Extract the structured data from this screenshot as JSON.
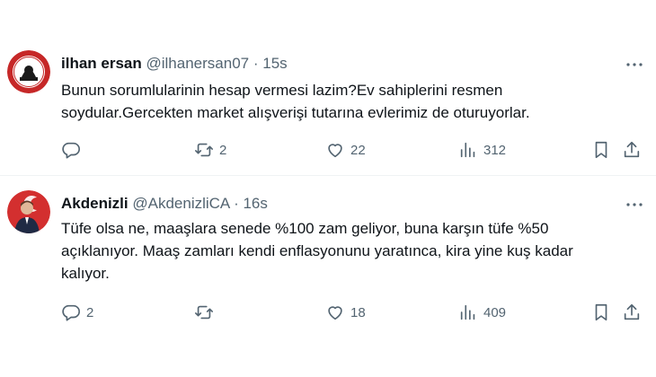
{
  "tweets": [
    {
      "name": "ilhan ersan",
      "handle": "@ilhanersan07",
      "sep": "·",
      "time": "15s",
      "text_line1": "Bunun sorumlularinin hesap vermesi lazim?Ev sahiplerini resmen",
      "text_line2": "soydular.Gercekten market alışverişi tutarına evlerimiz de oturuyorlar.",
      "text_line3": "",
      "replies": "",
      "retweets": "2",
      "likes": "22",
      "views": "312"
    },
    {
      "name": "Akdenizli",
      "handle": "@AkdenizliCA",
      "sep": "·",
      "time": "16s",
      "text_line1": "Tüfe olsa ne, maaşlara senede %100 zam geliyor, buna karşın tüfe %50",
      "text_line2": "açıklanıyor. Maaş zamları kendi enflasyonunu yaratınca, kira yine kuş kadar",
      "text_line3": "kalıyor.",
      "replies": "2",
      "retweets": "",
      "likes": "18",
      "views": "409"
    }
  ],
  "icons": {
    "reply": "reply-icon",
    "retweet": "retweet-icon",
    "like": "heart-icon",
    "views": "views-icon",
    "bookmark": "bookmark-icon",
    "share": "share-icon",
    "more": "more-icon"
  },
  "colors": {
    "text": "#0f1419",
    "secondary": "#536471",
    "divider": "#eff3f4",
    "avatar1_ring": "#c62828",
    "avatar2_bg": "#d32f2f"
  }
}
